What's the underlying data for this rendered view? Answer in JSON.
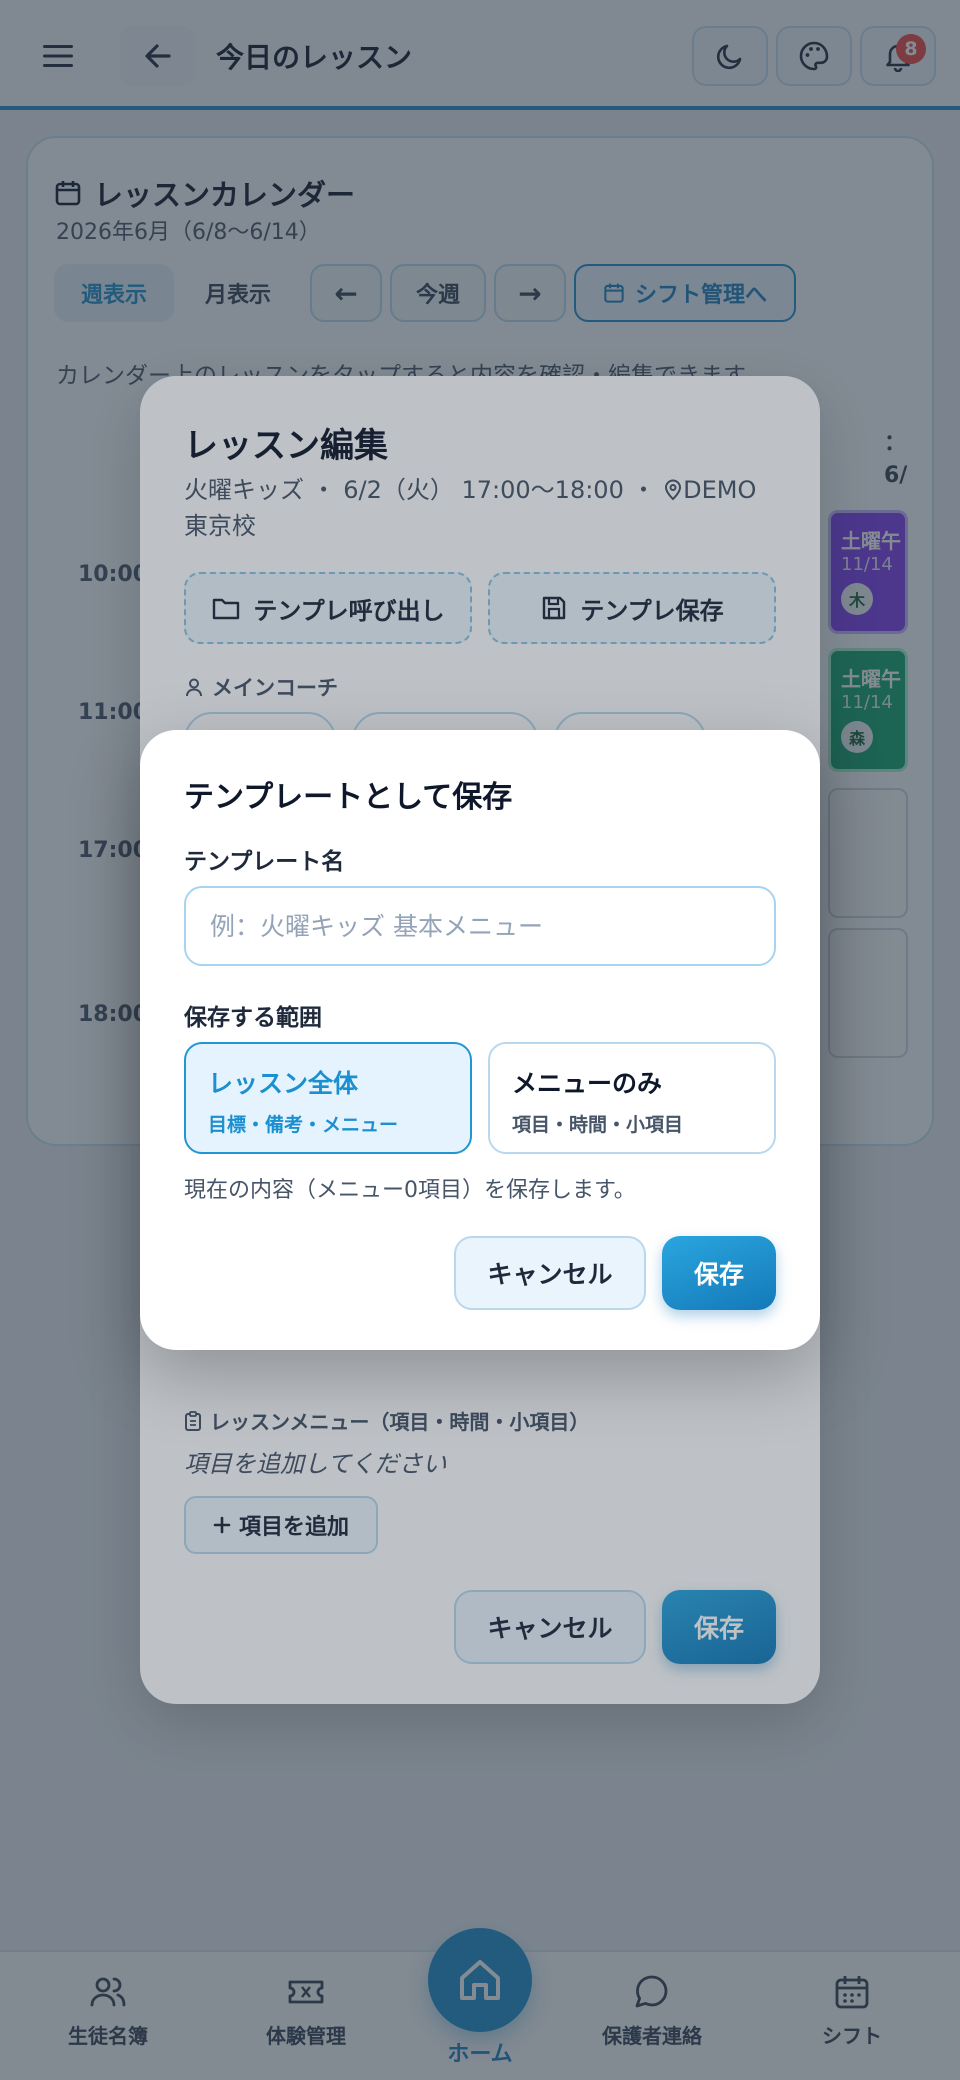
{
  "header": {
    "title": "今日のレッスン",
    "notification_count": "8"
  },
  "calendar": {
    "title": "レッスンカレンダー",
    "subtitle": "2026年6月（6/8〜6/14）",
    "view_week": "週表示",
    "view_month": "月表示",
    "prev": "←",
    "today": "今週",
    "next": "→",
    "shift_link": "シフト管理へ",
    "hint": "カレンダー上のレッスンをタップすると内容を確認・編集できます。",
    "day_head_1": "：",
    "day_head_2": "6/",
    "times": [
      "10:00",
      "11:00",
      "17:00",
      "18:00"
    ],
    "events": [
      {
        "title": "土曜午",
        "date": "11/14",
        "chip": "木"
      },
      {
        "title": "土曜午",
        "date": "11/14",
        "chip": "森"
      }
    ]
  },
  "edit_modal": {
    "title": "レッスン編集",
    "meta": "火曜キッズ ・ 6/2（火） 17:00〜18:00 ・ ",
    "location": "DEMO 東京校",
    "template_load": "テンプレ呼び出し",
    "template_save": "テンプレ保存",
    "coach_label": "メインコーチ",
    "menu_label": "レッスンメニュー（項目・時間・小項目）",
    "menu_empty": "項目を追加してください",
    "add_item": "項目を追加",
    "cancel": "キャンセル",
    "save": "保存"
  },
  "save_dialog": {
    "title": "テンプレートとして保存",
    "name_label": "テンプレート名",
    "name_placeholder": "例：火曜キッズ 基本メニュー",
    "name_value": "",
    "scope_label": "保存する範囲",
    "scope_all_title": "レッスン全体",
    "scope_all_sub": "目標・備考・メニュー",
    "scope_menu_title": "メニューのみ",
    "scope_menu_sub": "項目・時間・小項目",
    "selected_scope": "レッスン全体",
    "note": "現在の内容（メニュー0項目）を保存します。",
    "cancel": "キャンセル",
    "save": "保存"
  },
  "bottom_nav": {
    "students": "生徒名簿",
    "trial": "体験管理",
    "home": "ホーム",
    "parents": "保護者連絡",
    "shift": "シフト"
  },
  "colors": {
    "accent": "#1f8ecf",
    "event_purple": "#7c3aed",
    "event_green": "#10a36d",
    "badge": "#ef4444"
  }
}
